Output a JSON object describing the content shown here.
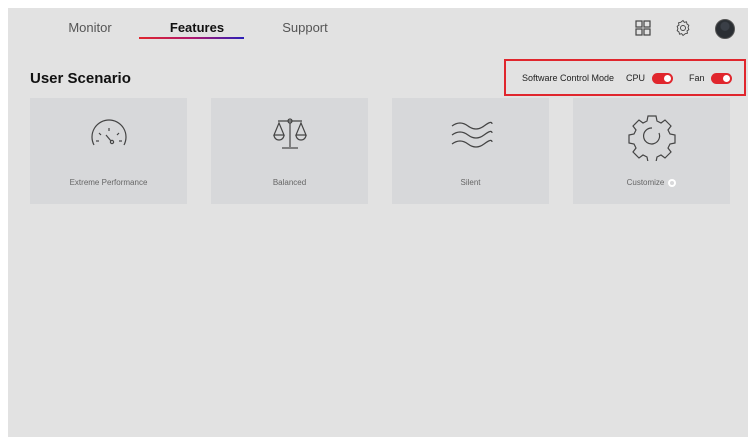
{
  "nav": {
    "tabs": [
      {
        "label": "Monitor"
      },
      {
        "label": "Features"
      },
      {
        "label": "Support"
      }
    ]
  },
  "section": {
    "title": "User Scenario"
  },
  "control": {
    "mode_label": "Software Control Mode",
    "cpu_label": "CPU",
    "fan_label": "Fan",
    "cpu_on": true,
    "fan_on": true,
    "accent_color": "#e0262d"
  },
  "cards": [
    {
      "label": "Extreme Performance",
      "icon": "speedometer-icon"
    },
    {
      "label": "Balanced",
      "icon": "scale-icon"
    },
    {
      "label": "Silent",
      "icon": "waves-icon"
    },
    {
      "label": "Customize",
      "icon": "gear-icon"
    }
  ]
}
